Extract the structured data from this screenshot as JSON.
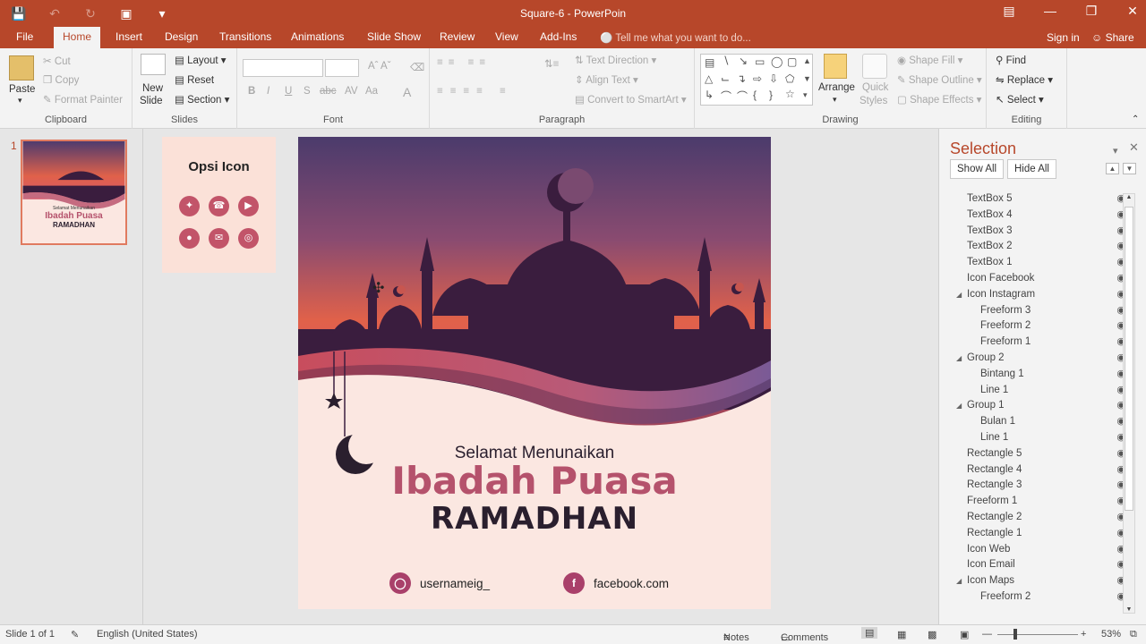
{
  "window": {
    "title": "Square-6 - PowerPoin",
    "controls": [
      "ribbon-display-icon",
      "minimize-icon",
      "restore-icon",
      "close-icon"
    ]
  },
  "quick_access": [
    "save-icon",
    "undo-icon",
    "redo-icon",
    "start-from-beginning-icon",
    "customize-icon"
  ],
  "tabs": [
    "File",
    "Home",
    "Insert",
    "Design",
    "Transitions",
    "Animations",
    "Slide Show",
    "Review",
    "View",
    "Add-Ins"
  ],
  "tell_me": "Tell me what you want to do...",
  "account": {
    "signin": "Sign in",
    "share": "Share"
  },
  "ribbon": {
    "clipboard": {
      "paste": "Paste",
      "cut": "Cut",
      "copy": "Copy",
      "format_painter": "Format Painter",
      "label": "Clipboard"
    },
    "slides": {
      "new_slide": "New",
      "new_slide2": "Slide",
      "layout": "Layout",
      "reset": "Reset",
      "section": "Section",
      "label": "Slides"
    },
    "font": {
      "label": "Font",
      "buttons": [
        "B",
        "I",
        "U",
        "S",
        "abc",
        "AV",
        "Aa",
        "A"
      ]
    },
    "paragraph": {
      "text_direction": "Text Direction",
      "align_text": "Align Text",
      "convert_smartart": "Convert to SmartArt",
      "label": "Paragraph"
    },
    "drawing": {
      "arrange": "Arrange",
      "quick_styles": "Quick",
      "quick_styles2": "Styles",
      "shape_fill": "Shape Fill",
      "shape_outline": "Shape Outline",
      "shape_effects": "Shape Effects",
      "label": "Drawing"
    },
    "editing": {
      "find": "Find",
      "replace": "Replace",
      "select": "Select",
      "label": "Editing"
    }
  },
  "thumbnail": {
    "number": "1",
    "line1": "Selamat Menunaikan",
    "line2": "Ibadah Puasa",
    "line3": "RAMADHAN"
  },
  "icon_card": {
    "title": "Opsi Icon",
    "icons": [
      "twitter-icon",
      "phone-icon",
      "youtube-icon",
      "maps-icon",
      "email-icon",
      "web-icon"
    ]
  },
  "slide": {
    "line1": "Selamat Menunaikan",
    "line2": "Ibadah Puasa",
    "line3": "RAMADHAN",
    "instagram": "usernameig_",
    "facebook": "facebook.com",
    "colors": {
      "sky_top": "#4e3b6e",
      "sky_glow": "#e0614a",
      "silhouette": "#3a1d3e",
      "wave": "#c56b80",
      "title_pink": "#b5526c"
    }
  },
  "selection": {
    "title": "Selection",
    "show_all": "Show All",
    "hide_all": "Hide All",
    "items": [
      {
        "label": "TextBox 5",
        "level": 0
      },
      {
        "label": "TextBox 4",
        "level": 0
      },
      {
        "label": "TextBox 3",
        "level": 0
      },
      {
        "label": "TextBox 2",
        "level": 0
      },
      {
        "label": "TextBox 1",
        "level": 0
      },
      {
        "label": "Icon Facebook",
        "level": 0
      },
      {
        "label": "Icon Instagram",
        "level": 0,
        "group": true
      },
      {
        "label": "Freeform 3",
        "level": 1
      },
      {
        "label": "Freeform 2",
        "level": 1
      },
      {
        "label": "Freeform 1",
        "level": 1
      },
      {
        "label": "Group 2",
        "level": 0,
        "group": true
      },
      {
        "label": "Bintang 1",
        "level": 1
      },
      {
        "label": "Line 1",
        "level": 1
      },
      {
        "label": "Group 1",
        "level": 0,
        "group": true
      },
      {
        "label": "Bulan 1",
        "level": 1
      },
      {
        "label": "Line 1",
        "level": 1
      },
      {
        "label": "Rectangle 5",
        "level": 0
      },
      {
        "label": "Rectangle 4",
        "level": 0
      },
      {
        "label": "Rectangle 3",
        "level": 0
      },
      {
        "label": "Freeform 1",
        "level": 0
      },
      {
        "label": "Rectangle 2",
        "level": 0
      },
      {
        "label": "Rectangle 1",
        "level": 0
      },
      {
        "label": "Icon Web",
        "level": 0
      },
      {
        "label": "Icon Email",
        "level": 0
      },
      {
        "label": "Icon Maps",
        "level": 0,
        "group": true
      },
      {
        "label": "Freeform 2",
        "level": 1
      }
    ]
  },
  "status": {
    "slide": "Slide 1 of 1",
    "language": "English (United States)",
    "notes": "Notes",
    "comments": "Comments",
    "zoom": "53%"
  }
}
